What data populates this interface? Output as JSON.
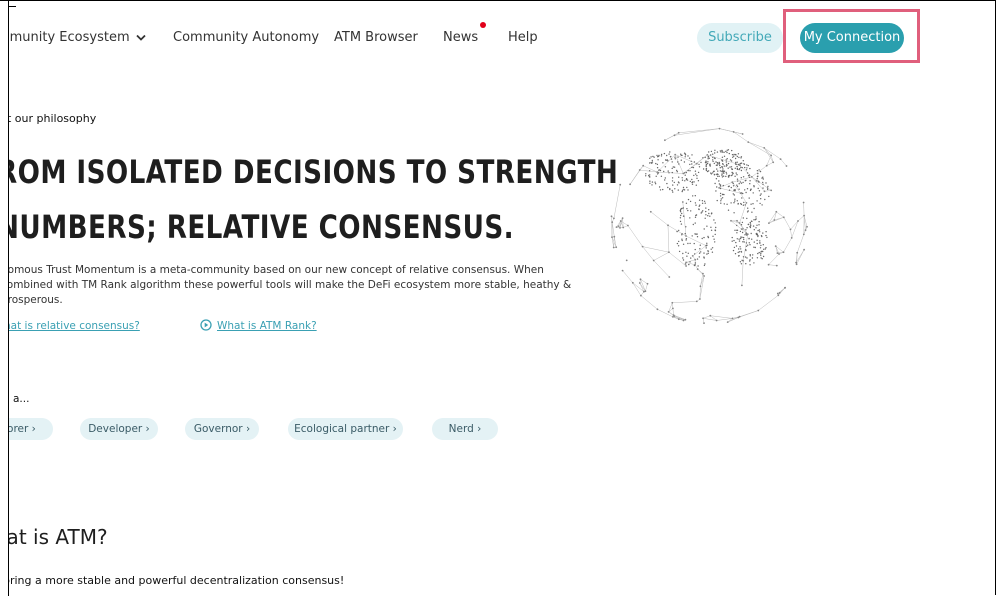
{
  "nav": {
    "items": [
      {
        "label": "ımunity Ecosystem"
      },
      {
        "label": "Community Autonomy"
      },
      {
        "label": "ATM Browser"
      },
      {
        "label": "News"
      },
      {
        "label": "Help"
      }
    ],
    "subscribe_label": "Subscribe",
    "connect_label": "My Connection"
  },
  "hero": {
    "eyebrow": "ut our philosophy",
    "headline_line1": "ROM ISOLATED DECISIONS TO STRENGTH",
    "headline_line2": "NUMBERS; RELATIVE CONSENSUS.",
    "description": "nomous Trust Momentum is a meta-community based on our new concept of relative consensus. When combined with TM Rank algorithm these powerful tools will make the DeFi ecosystem more stable, heathy & prosperous.",
    "link_relative": "hat is relative consensus?",
    "link_rank": "What is ATM Rank?"
  },
  "roles": {
    "heading": "n a...",
    "pills": [
      {
        "label": "lorer ›"
      },
      {
        "label": "Developer ›"
      },
      {
        "label": "Governor ›"
      },
      {
        "label": "Ecological partner ›"
      },
      {
        "label": "Nerd ›"
      }
    ]
  },
  "about": {
    "heading": "ıat is ATM?",
    "subheading": "bring a more stable and powerful decentralization consensus!"
  },
  "colors": {
    "accent": "#2a9fae",
    "subscribe_bg": "#e1f2f5",
    "highlight": "#e05f7c",
    "news_dot": "#e1001a"
  },
  "icons": [
    "chevron-down-icon",
    "play-circle-icon",
    "globe-illustration"
  ]
}
